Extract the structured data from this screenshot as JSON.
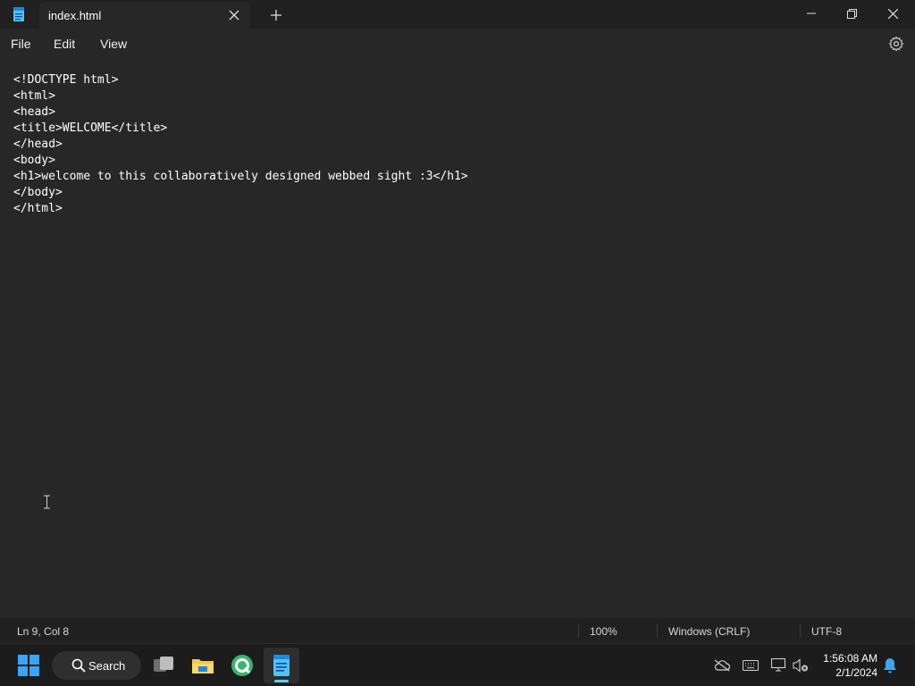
{
  "window": {
    "tab_title": "index.html",
    "icons": {
      "app": "notepad-icon",
      "close_tab": "close-icon",
      "new_tab": "plus-icon",
      "minimize": "minimize-icon",
      "maximize": "restore-icon",
      "close": "close-icon"
    }
  },
  "menu": {
    "file": "File",
    "edit": "Edit",
    "view": "View",
    "settings_icon": "gear-icon"
  },
  "editor": {
    "lines": [
      "<!DOCTYPE html>",
      "<html>",
      "<head>",
      "<title>WELCOME</title>",
      "</head>",
      "<body>",
      "<h1>welcome to this collaboratively designed webbed sight :3</h1>",
      "</body>",
      "</html>"
    ]
  },
  "status": {
    "position": "Ln 9, Col 8",
    "zoom": "100%",
    "line_ending": "Windows (CRLF)",
    "encoding": "UTF-8"
  },
  "taskbar": {
    "search_label": "Search",
    "apps": [
      "start-icon",
      "task-view-icon",
      "file-explorer-icon",
      "q-app-icon",
      "notepad-icon"
    ],
    "tray": [
      "onedrive-offline-icon",
      "keyboard-icon",
      "network-icon",
      "volume-muted-icon",
      "bell-icon"
    ],
    "time": "1:56:08 AM",
    "date": "2/1/2024"
  },
  "colors": {
    "background": "#272727",
    "titlebar": "#202020",
    "accent": "#60cdff"
  }
}
